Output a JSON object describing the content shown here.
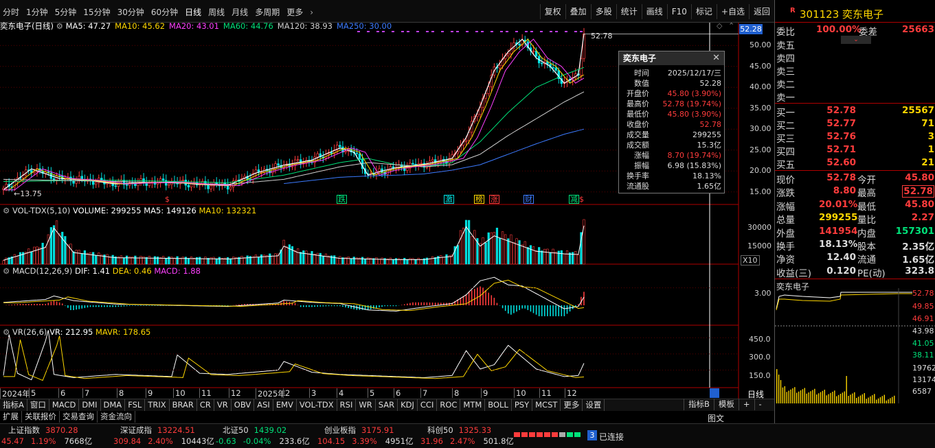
{
  "toolbar": {
    "periods": [
      "分时",
      "1分钟",
      "5分钟",
      "15分钟",
      "30分钟",
      "60分钟",
      "日线",
      "周线",
      "月线",
      "多周期",
      "更多"
    ],
    "actions": [
      "复权",
      "叠加",
      "多股",
      "统计",
      "画线",
      "F10",
      "标记",
      "+自选",
      "返回"
    ]
  },
  "price_panel": {
    "name": "奕东电子(日线)",
    "ma": [
      {
        "label": "MA5: 47.27",
        "color": "#ffffff"
      },
      {
        "label": "MA10: 45.62",
        "color": "#ffd700"
      },
      {
        "label": "MA20: 43.01",
        "color": "#ff40ff"
      },
      {
        "label": "MA60: 44.76",
        "color": "#00e27a"
      },
      {
        "label": "MA120: 38.93",
        "color": "#d0d0d0"
      },
      {
        "label": "MA250: 30.00",
        "color": "#3c7bff"
      }
    ],
    "current_price_label": "52.28",
    "high_mark": "52.78",
    "low_mark": "13.75",
    "yaxis": [
      "50.00",
      "45.00",
      "40.00",
      "35.00",
      "30.00",
      "25.00",
      "20.00",
      "15.00"
    ],
    "events": [
      {
        "label": "跌",
        "color": "#00e27a"
      },
      {
        "label": "激",
        "color": "#00e0e0"
      },
      {
        "label": "榜",
        "color": "#ffd700"
      },
      {
        "label": "涨",
        "color": "#ff3c3c"
      },
      {
        "label": "财",
        "color": "#3c7bff"
      },
      {
        "label": "减",
        "color": "#00e27a"
      },
      {
        "label": "$",
        "color": "#ff3c3c"
      },
      {
        "label": "$",
        "color": "#ff3c3c"
      },
      {
        "label": "$",
        "color": "#ff3c3c"
      }
    ]
  },
  "tooltip": {
    "title": "奕东电子",
    "rows": [
      {
        "k": "时间",
        "v": "2025/12/17/三",
        "c": "#dddddd"
      },
      {
        "k": "数值",
        "v": "52.28",
        "c": "#dddddd"
      },
      {
        "k": "开盘价",
        "v": "45.80 (3.90%)",
        "c": "#ff3c3c"
      },
      {
        "k": "最高价",
        "v": "52.78 (19.74%)",
        "c": "#ff3c3c"
      },
      {
        "k": "最低价",
        "v": "45.80 (3.90%)",
        "c": "#ff3c3c"
      },
      {
        "k": "收盘价",
        "v": "52.78",
        "c": "#ff3c3c"
      },
      {
        "k": "成交量",
        "v": "299255",
        "c": "#dddddd"
      },
      {
        "k": "成交额",
        "v": "15.3亿",
        "c": "#dddddd"
      },
      {
        "k": "涨幅",
        "v": "8.70 (19.74%)",
        "c": "#ff3c3c"
      },
      {
        "k": "振幅",
        "v": "6.98 (15.83%)",
        "c": "#dddddd"
      },
      {
        "k": "换手率",
        "v": "18.13%",
        "c": "#dddddd"
      },
      {
        "k": "流通股",
        "v": "1.65亿",
        "c": "#dddddd"
      }
    ]
  },
  "volume_panel": {
    "title": "VOL-TDX(5,10)",
    "volume": "VOLUME: 299255",
    "ma5": "MA5: 149126",
    "ma10": "MA10: 132321",
    "yaxis": [
      "30000",
      "15000"
    ],
    "multiplier": "X10"
  },
  "macd_panel": {
    "title": "MACD(12,26,9)",
    "dif": "DIF: 1.41",
    "dea": "DEA: 0.46",
    "macd": "MACD: 1.88",
    "yaxis": [
      "3.00"
    ]
  },
  "vr_panel": {
    "title": "VR(26,6)",
    "vr": "VR: 212.95",
    "mavr": "MAVR: 178.65",
    "yaxis": [
      "450.0",
      "300.0",
      "150.0"
    ]
  },
  "xaxis": {
    "labels": [
      "2024年",
      "5",
      "6",
      "7",
      "8",
      "9",
      "10",
      "11",
      "12",
      "2025年",
      "2",
      "3",
      "4",
      "5",
      "6",
      "7",
      "8",
      "9",
      "10",
      "11",
      "12"
    ],
    "right_label": "日线"
  },
  "indicator_tabs": [
    "指标A",
    "窗口",
    "MACD",
    "DMI",
    "DMA",
    "FSL",
    "TRIX",
    "BRAR",
    "CR",
    "VR",
    "OBV",
    "ASI",
    "EMV",
    "VOL-TDX",
    "RSI",
    "WR",
    "SAR",
    "KDJ",
    "CCI",
    "ROC",
    "MTM",
    "BOLL",
    "PSY",
    "MCST",
    "更多",
    "设置"
  ],
  "right_tabs": [
    "指标B",
    "模板",
    "+",
    "-"
  ],
  "bottom_tabs": [
    "扩展",
    "关联报价",
    "交易查询",
    "资金流向"
  ],
  "status": {
    "indices": [
      {
        "name": "上证指数",
        "value": "3870.28",
        "change": "45.47",
        "pct": "1.19%",
        "amount": "7668亿",
        "color": "#ff3c3c"
      },
      {
        "name": "深证成指",
        "value": "13224.51",
        "change": "309.84",
        "pct": "2.40%",
        "amount": "10443亿",
        "color": "#ff3c3c"
      },
      {
        "name": "北证50",
        "value": "1439.02",
        "change": "-0.63",
        "pct": "-0.04%",
        "amount": "233.6亿",
        "color": "#00e27a"
      },
      {
        "name": "创业板指",
        "value": "3175.91",
        "change": "104.15",
        "pct": "3.39%",
        "amount": "4951亿",
        "color": "#ff3c3c"
      },
      {
        "name": "科创50",
        "value": "1325.33",
        "change": "31.96",
        "pct": "2.47%",
        "amount": "501.8亿",
        "color": "#ff3c3c"
      }
    ],
    "connect_num": "3",
    "connect_text": "已连接",
    "bottom_right": "图文"
  },
  "quote": {
    "badge": "R",
    "code": "301123",
    "name": "奕东电子",
    "weibi_label": "委比",
    "weibi": "100.00%",
    "weicha_label": "委差",
    "weicha": "25663",
    "sells": [
      {
        "l": "卖五",
        "p": "",
        "q": ""
      },
      {
        "l": "卖四",
        "p": "",
        "q": ""
      },
      {
        "l": "卖三",
        "p": "",
        "q": ""
      },
      {
        "l": "卖二",
        "p": "",
        "q": ""
      },
      {
        "l": "卖一",
        "p": "",
        "q": ""
      }
    ],
    "buys": [
      {
        "l": "买一",
        "p": "52.78",
        "q": "25567"
      },
      {
        "l": "买二",
        "p": "52.77",
        "q": "71"
      },
      {
        "l": "买三",
        "p": "52.76",
        "q": "3"
      },
      {
        "l": "买四",
        "p": "52.71",
        "q": "1"
      },
      {
        "l": "买五",
        "p": "52.60",
        "q": "21"
      }
    ],
    "stats": [
      {
        "l1": "现价",
        "v1": "52.78",
        "c1": "#ff3c3c",
        "l2": "今开",
        "v2": "45.80",
        "c2": "#ff3c3c"
      },
      {
        "l1": "涨跌",
        "v1": "8.80",
        "c1": "#ff3c3c",
        "l2": "最高",
        "v2": "52.78",
        "c2": "#ff3c3c"
      },
      {
        "l1": "涨幅",
        "v1": "20.01%",
        "c1": "#ff3c3c",
        "l2": "最低",
        "v2": "45.80",
        "c2": "#ff3c3c"
      },
      {
        "l1": "总量",
        "v1": "299255",
        "c1": "#ffd700",
        "l2": "量比",
        "v2": "2.27",
        "c2": "#ff3c3c"
      },
      {
        "l1": "外盘",
        "v1": "141954",
        "c1": "#ff3c3c",
        "l2": "内盘",
        "v2": "157301",
        "c2": "#00e27a"
      },
      {
        "l1": "换手",
        "v1": "18.13%",
        "c1": "#dddddd",
        "l2": "股本",
        "v2": "2.35亿",
        "c2": "#dddddd"
      },
      {
        "l1": "净资",
        "v1": "12.40",
        "c1": "#dddddd",
        "l2": "流通",
        "v2": "1.65亿",
        "c2": "#dddddd"
      },
      {
        "l1": "收益(三)",
        "v1": "0.120",
        "c1": "#dddddd",
        "l2": "PE(动)",
        "v2": "323.8",
        "c2": "#dddddd"
      }
    ],
    "mini_title": "奕东电子",
    "mini_price_axis": [
      "52.78",
      "49.85",
      "46.91",
      "43.98",
      "41.05",
      "38.11"
    ],
    "mini_vol_axis": [
      "19762",
      "13174",
      "6587"
    ]
  },
  "chart_data": {
    "type": "line",
    "title": "奕东电子(日线)",
    "price_range": [
      12,
      53
    ],
    "series": [
      {
        "name": "收盘价",
        "color": "#ffffff",
        "x": [
          0,
          10,
          20,
          30,
          40,
          50,
          60,
          70,
          80,
          90,
          100,
          110,
          120,
          125,
          130,
          135,
          140,
          150,
          160,
          165,
          170,
          175,
          180,
          185,
          190,
          195,
          200,
          205,
          207
        ],
        "values": [
          15.5,
          20.5,
          18.2,
          17.8,
          16.9,
          17.2,
          17.3,
          16.8,
          16.5,
          19.5,
          21.4,
          22.6,
          25.5,
          24.5,
          19.0,
          20.0,
          20.8,
          21.6,
          23.0,
          28.0,
          35.5,
          44.0,
          48.5,
          51.5,
          47.0,
          45.0,
          41.0,
          43.0,
          52.78
        ]
      },
      {
        "name": "MA60",
        "color": "#00e27a",
        "x": [
          0,
          40,
          60,
          80,
          100,
          120,
          130,
          140,
          150,
          160,
          170,
          180,
          190,
          200,
          207
        ],
        "values": [
          17.5,
          17.8,
          17.5,
          17.2,
          19.0,
          22.0,
          23.0,
          21.5,
          21.0,
          22.0,
          27.0,
          34.0,
          40.0,
          43.0,
          44.76
        ]
      },
      {
        "name": "MA120",
        "color": "#d0d0d0",
        "x": [
          0,
          40,
          80,
          100,
          120,
          130,
          140,
          150,
          160,
          170,
          180,
          190,
          200,
          207
        ],
        "values": [
          18.0,
          17.5,
          16.8,
          18.0,
          21.0,
          22.0,
          21.5,
          21.0,
          21.5,
          24.0,
          28.5,
          32.5,
          36.5,
          38.93
        ]
      },
      {
        "name": "MA250",
        "color": "#3c7bff",
        "x": [
          100,
          120,
          130,
          140,
          150,
          160,
          170,
          180,
          190,
          200,
          207
        ],
        "values": [
          17.0,
          18.5,
          18.8,
          19.0,
          19.3,
          20.2,
          21.5,
          24.0,
          26.5,
          28.8,
          30.0
        ]
      }
    ],
    "volume": {
      "x": [
        0,
        15,
        18,
        25,
        40,
        60,
        80,
        98,
        100,
        105,
        120,
        140,
        150,
        155,
        160,
        165,
        170,
        175,
        180,
        190,
        200,
        205,
        207
      ],
      "values": [
        3000,
        13000,
        28000,
        9000,
        5000,
        4500,
        4000,
        6500,
        14000,
        9000,
        4500,
        3500,
        3500,
        5000,
        6000,
        29000,
        14000,
        22000,
        18000,
        10000,
        8000,
        7500,
        29900
      ]
    },
    "macd_dif": {
      "x": [
        0,
        15,
        18,
        25,
        40,
        60,
        80,
        98,
        100,
        110,
        120,
        130,
        140,
        150,
        160,
        165,
        170,
        175,
        180,
        185,
        190,
        200,
        205,
        207
      ],
      "values": [
        0.5,
        1.0,
        1.6,
        0.8,
        0.2,
        0.0,
        -0.2,
        0.4,
        0.9,
        0.5,
        0.3,
        -0.8,
        -1.0,
        -0.3,
        0.3,
        1.8,
        4.2,
        4.8,
        3.5,
        3.3,
        2.0,
        -0.6,
        -0.2,
        1.41
      ]
    },
    "vr": {
      "x": [
        0,
        2,
        5,
        10,
        15,
        16,
        18,
        25,
        40,
        60,
        62,
        70,
        80,
        98,
        100,
        110,
        120,
        130,
        140,
        150,
        160,
        165,
        170,
        175,
        180,
        190,
        200,
        205,
        207
      ],
      "values": [
        100,
        480,
        120,
        60,
        420,
        520,
        110,
        80,
        110,
        90,
        290,
        120,
        110,
        150,
        230,
        130,
        110,
        100,
        90,
        80,
        100,
        330,
        160,
        200,
        380,
        160,
        90,
        100,
        212.95
      ]
    }
  }
}
